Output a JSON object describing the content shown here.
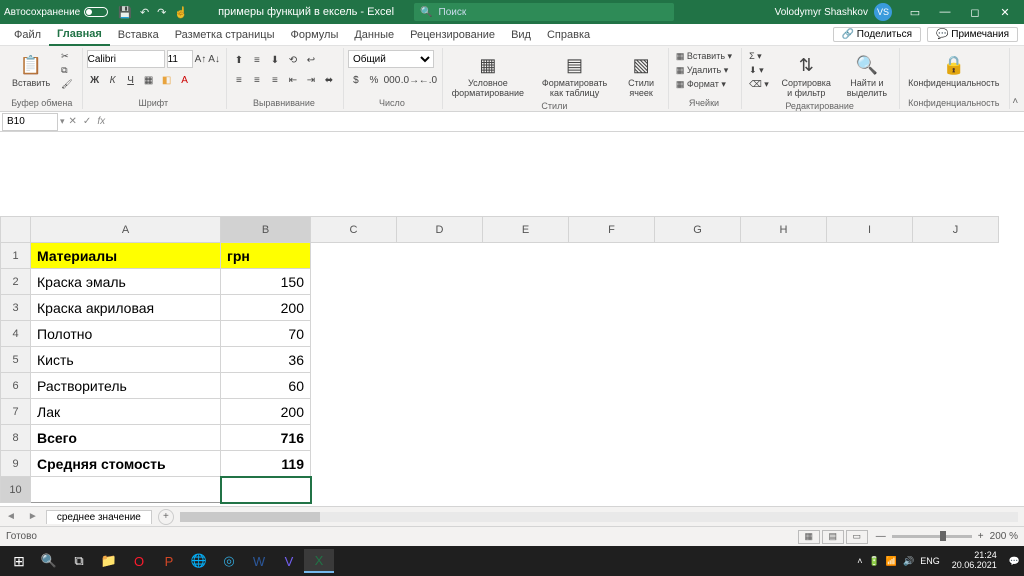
{
  "title": {
    "autosave": "Автосохранение",
    "doc": "примеры функций в ексель - Excel",
    "search": "Поиск",
    "user": "Volodymyr Shashkov",
    "initials": "VS"
  },
  "menu": {
    "file": "Файл",
    "home": "Главная",
    "insert": "Вставка",
    "layout": "Разметка страницы",
    "formulas": "Формулы",
    "data": "Данные",
    "review": "Рецензирование",
    "view": "Вид",
    "help": "Справка",
    "share": "Поделиться",
    "comments": "Примечания"
  },
  "ribbon": {
    "clipboard": {
      "paste": "Вставить",
      "label": "Буфер обмена"
    },
    "font": {
      "name": "Calibri",
      "size": "11",
      "label": "Шрифт"
    },
    "align": {
      "label": "Выравнивание"
    },
    "number": {
      "format": "Общий",
      "label": "Число"
    },
    "styles": {
      "cond": "Условное форматирование",
      "table": "Форматировать как таблицу",
      "cell": "Стили ячеек",
      "label": "Стили"
    },
    "cells": {
      "insert": "Вставить",
      "delete": "Удалить",
      "format": "Формат",
      "label": "Ячейки"
    },
    "editing": {
      "sort": "Сортировка и фильтр",
      "find": "Найти и выделить",
      "label": "Редактирование"
    },
    "conf": {
      "btn": "Конфиденциальность",
      "label": "Конфиденциальность"
    }
  },
  "namebox": "B10",
  "columns": [
    "A",
    "B",
    "C",
    "D",
    "E",
    "F",
    "G",
    "H",
    "I",
    "J"
  ],
  "table": {
    "header": {
      "a": "Материалы",
      "b": "грн"
    },
    "rows": [
      {
        "a": "Краска эмаль",
        "b": "150"
      },
      {
        "a": "Краска акриловая",
        "b": "200"
      },
      {
        "a": "Полотно",
        "b": "70"
      },
      {
        "a": "Кисть",
        "b": "36"
      },
      {
        "a": "Растворитель",
        "b": "60"
      },
      {
        "a": "Лак",
        "b": "200"
      }
    ],
    "total": {
      "a": "Всего",
      "b": "716"
    },
    "avg": {
      "a": "Средняя стомость",
      "b": "119"
    }
  },
  "sheettab": "среднее значение",
  "status": {
    "ready": "Готово",
    "zoom": "200 %"
  },
  "taskbar": {
    "lang": "ENG",
    "time": "21:24",
    "date": "20.06.2021"
  }
}
